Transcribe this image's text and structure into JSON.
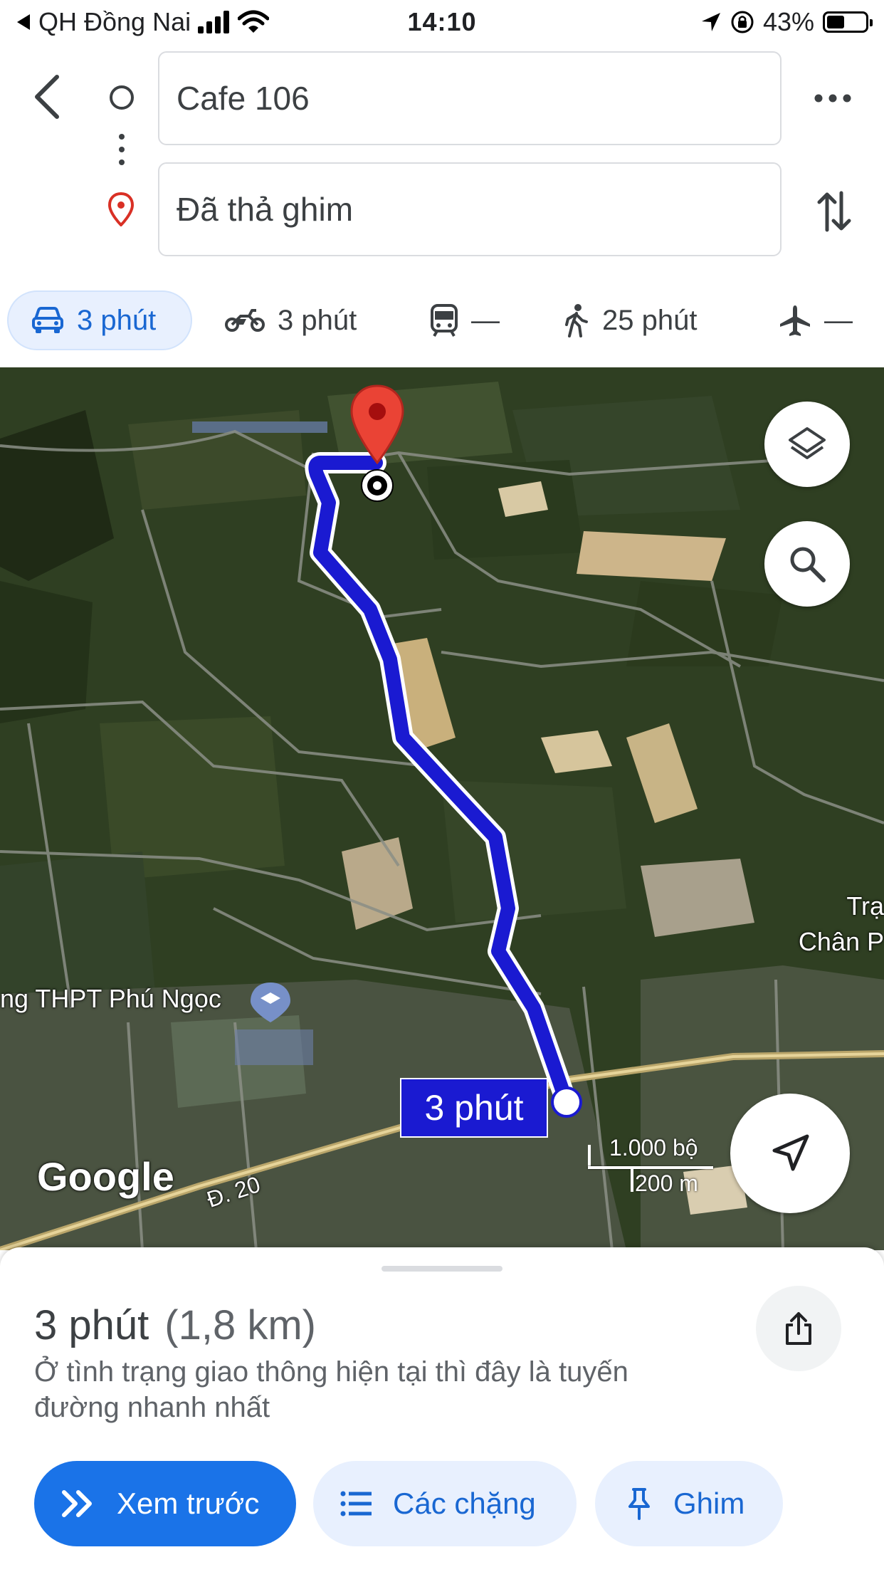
{
  "status_bar": {
    "back_app": "QH Đồng Nai",
    "time": "14:10",
    "battery": "43%"
  },
  "route": {
    "origin": "Cafe 106",
    "destination": "Đã thả ghim"
  },
  "modes": [
    {
      "name": "car",
      "label": "3 phút",
      "active": true
    },
    {
      "name": "motorbike",
      "label": "3 phút"
    },
    {
      "name": "transit",
      "label": "—"
    },
    {
      "name": "walk",
      "label": "25 phút"
    },
    {
      "name": "flight",
      "label": "—"
    }
  ],
  "map": {
    "school_label": "ng THPT Phú Ngọc",
    "place_label_1": "Trạ",
    "place_label_2": "Chân P",
    "road_label": "Đ. 20",
    "route_badge": "3 phút",
    "scale_imperial": "1.000 bộ",
    "scale_metric": "200 m",
    "logo": "Google",
    "route_color": "#1a1ad1",
    "pin_color": "#ea4335"
  },
  "sheet": {
    "duration": "3 phút",
    "distance": "(1,8 km)",
    "description": "Ở tình trạng giao thông hiện tại thì đây là tuyến đường nhanh nhất",
    "preview_label": "Xem trước",
    "steps_label": "Các chặng",
    "pin_label": "Ghim"
  },
  "colors": {
    "accent": "#1a73e8",
    "accent_text": "#1967d2",
    "chip_bg": "#e8f0fe"
  }
}
